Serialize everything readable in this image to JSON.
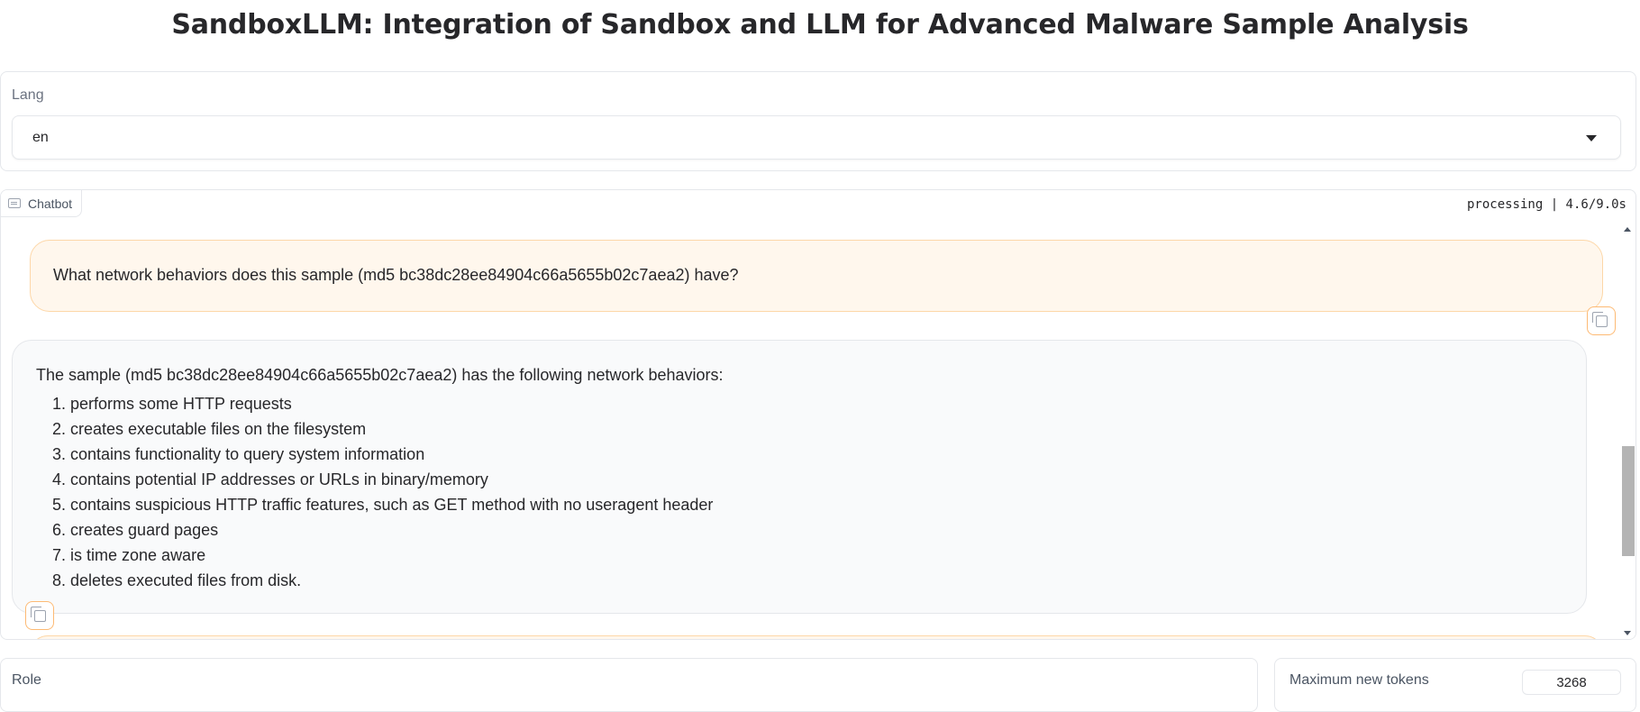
{
  "page": {
    "title": "SandboxLLM: Integration of Sandbox and LLM for Advanced Malware Sample Analysis"
  },
  "lang": {
    "label": "Lang",
    "selected": "en"
  },
  "chatbot": {
    "tab_label": "Chatbot",
    "status": "processing | 4.6/9.0s",
    "messages": [
      {
        "role": "user",
        "text": "What network behaviors does this sample (md5 bc38dc28ee84904c66a5655b02c7aea2) have?"
      },
      {
        "role": "bot",
        "intro": "The sample (md5 bc38dc28ee84904c66a5655b02c7aea2) has the following network behaviors:",
        "items": [
          "1. performs some HTTP requests",
          "2. creates executable files on the filesystem",
          "3. contains functionality to query system information",
          "4. contains potential IP addresses or URLs in binary/memory",
          "5. contains suspicious HTTP traffic features, such as GET method with no useragent header",
          "6. creates guard pages",
          "7. is time zone aware",
          "8. deletes executed files from disk."
        ]
      }
    ]
  },
  "role": {
    "label": "Role"
  },
  "max_tokens": {
    "label": "Maximum new tokens",
    "value": "3268"
  },
  "colors": {
    "user_bubble": "#fff7ed",
    "user_border": "#fdd7a8",
    "bot_bubble": "#f9fafb",
    "accent": "#fdba74"
  }
}
